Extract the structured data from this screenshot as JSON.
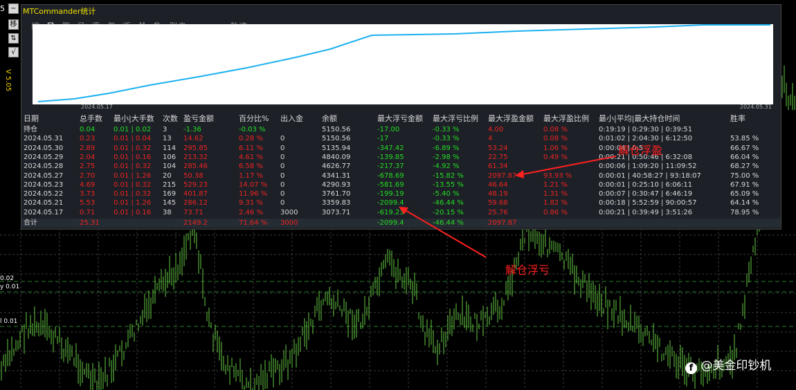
{
  "sidebar": {
    "top_number": "5",
    "buttons": [
      "−",
      "移",
      "⇅",
      "√"
    ],
    "version": "V 5.05",
    "y_labels": [
      "0.02",
      "y 0.01",
      "l 0.01"
    ]
  },
  "panel": {
    "title": "MTCommander统计",
    "tabs": [
      "综",
      "日",
      "周",
      "月",
      "季",
      "年",
      "币",
      "M",
      "备",
      "账户",
      "轨迹"
    ],
    "active_tab": "日",
    "chart": {
      "date_start": "2024.05.17",
      "date_end": "2024.05.31",
      "line_color": "#1ab0f0"
    }
  },
  "table": {
    "headers": [
      "日期",
      "总手数",
      "最小|大手数",
      "次数",
      "盈亏金额",
      "百分比%",
      "出入金",
      "余额",
      "最大浮亏金额",
      "最大浮亏比例",
      "最大浮盈金额",
      "最大浮盈比例",
      "最小|平均|最大持仓时间",
      "胜率"
    ],
    "rows": [
      [
        "持仓",
        "0.04",
        "0.01 | 0.02",
        "3",
        "-1.36",
        "-0.03 %",
        "",
        "5150.56",
        "-17.00",
        "-0.33 %",
        "4.00",
        "0.08 %",
        "0:19:19 | 0:29:30 | 0:39:51",
        ""
      ],
      [
        "2024.05.31",
        "0.23",
        "0.01 | 0.04",
        "13",
        "14.62",
        "0.28 %",
        "0",
        "5150.56",
        "-17",
        "-0.33 %",
        "4",
        "0.08 %",
        "0:01:02 | 2:04:30 | 6:12:50",
        "53.85 %"
      ],
      [
        "2024.05.30",
        "2.89",
        "0.01 | 0.32",
        "114",
        "295.85",
        "6.11 %",
        "0",
        "5135.94",
        "-347.42",
        "-6.89 %",
        "53.24",
        "1.06 %",
        "0:00:04 | 0:5",
        "66.67 %"
      ],
      [
        "2024.05.29",
        "2.04",
        "0.01 | 0.16",
        "106",
        "213.32",
        "4.61 %",
        "0",
        "4840.09",
        "-139.85",
        "-2.98 %",
        "22.75",
        "0.49 %",
        "0:00:21 | 0:50:46 | 6:32:08",
        "66.04 %"
      ],
      [
        "2024.05.28",
        "2.75",
        "0.01 | 0.32",
        "104",
        "285.46",
        "6.58 %",
        "0",
        "4626.77",
        "-217.37",
        "-4.92 %",
        "61.34",
        "",
        "0:00:06 | 1:09:20 | 11:09:52",
        "68.27 %"
      ],
      [
        "2024.05.27",
        "2.70",
        "0.01 | 1.26",
        "20",
        "50.38",
        "1.17 %",
        "0",
        "4341.31",
        "-678.69",
        "-15.82 %",
        "2097.87",
        "93.93 %",
        "0:00:01 | 40:58:27 | 93:18:07",
        "75.00 %"
      ],
      [
        "2024.05.23",
        "4.69",
        "0.01 | 0.32",
        "215",
        "529.23",
        "14.07 %",
        "0",
        "4290.93",
        "-581.69",
        "-13.55 %",
        "46.64",
        "1.21 %",
        "0:00:01 | 0:25:10 | 6:06:11",
        "67.91 %"
      ],
      [
        "2024.05.22",
        "3.73",
        "0.01 | 0.32",
        "169",
        "401.87",
        "11.96 %",
        "0",
        "3761.70",
        "-199.19",
        "-5.40 %",
        "48.19",
        "1.31 %",
        "0:00:07 | 0:30:47 | 6:46:19",
        "65.09 %"
      ],
      [
        "2024.05.21",
        "5.53",
        "0.01 | 1.26",
        "145",
        "286.12",
        "9.31 %",
        "0",
        "3359.83",
        "-2099.4",
        "-46.44 %",
        "59.68",
        "1.82 %",
        "0:00:18 | 5:52:59 | 90:00:57",
        "64.14 %"
      ],
      [
        "2024.05.17",
        "0.71",
        "0.01 | 0.16",
        "38",
        "73.71",
        "2.46 %",
        "3000",
        "3073.71",
        "-619.23",
        "-20.15 %",
        "25.76",
        "0.86 %",
        "0:00:21 | 0:39:49 | 3:51:26",
        "78.95 %"
      ]
    ],
    "total": [
      "合计",
      "25.31",
      "",
      "",
      "2149.2",
      "71.64 %",
      "3000",
      "",
      "-2099.4",
      "-46.44 %",
      "2097.87",
      "",
      "",
      ""
    ]
  },
  "annotations": {
    "top": "解仓浮盈",
    "bottom": "解仓浮亏",
    "color": "#ff2020"
  },
  "watermark": "@美金印钞机"
}
